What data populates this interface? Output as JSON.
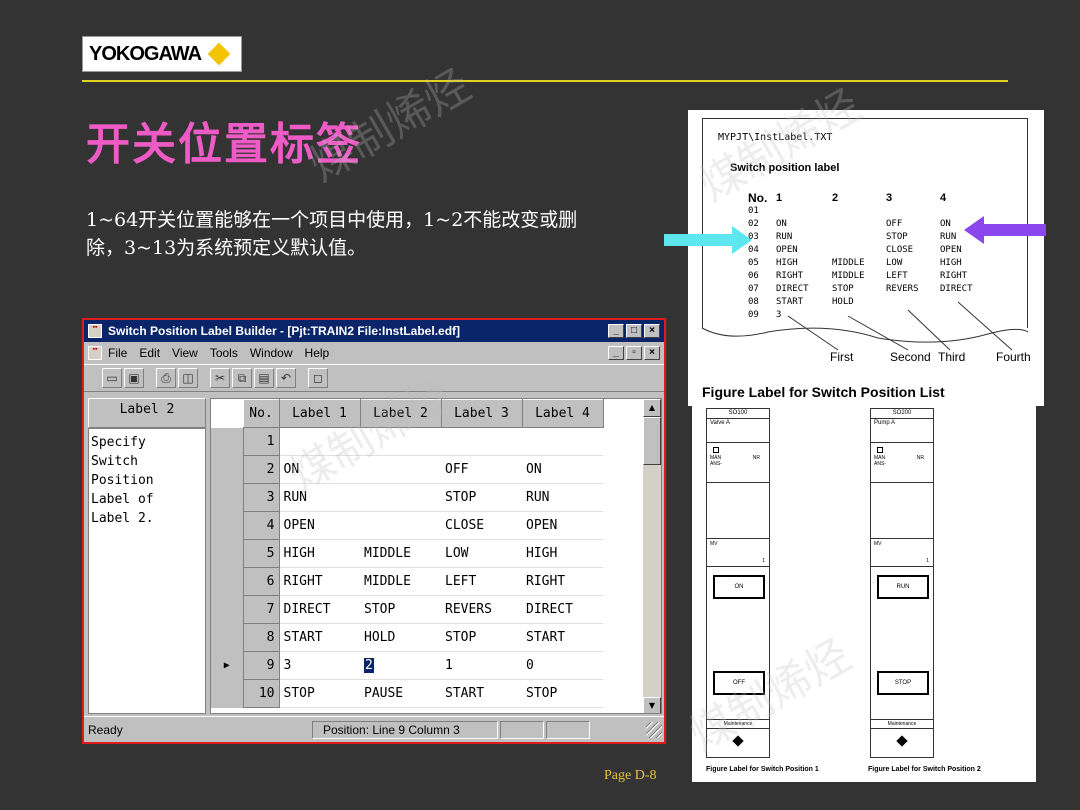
{
  "slide": {
    "logo_text": "YOKOGAWA",
    "title": "开关位置标签",
    "body_lines": [
      "1~64开关位置能够在一个项目中使用，1~2不能改变或删",
      "除，3~13为系统预定义默认值。"
    ],
    "page_num": "Page D-8",
    "watermark": "煤制烯烃"
  },
  "window": {
    "title": "Switch Position Label Builder - [Pjt:TRAIN2 File:InstLabel.edf]",
    "menu": [
      "File",
      "Edit",
      "View",
      "Tools",
      "Window",
      "Help"
    ],
    "left_panel": {
      "header": "Label 2",
      "description": "Specify\nSwitch\nPosition\nLabel of\nLabel 2."
    },
    "grid": {
      "headers": [
        "No.",
        "Label 1",
        "Label 2",
        "Label 3",
        "Label 4"
      ],
      "rows": [
        {
          "no": "1",
          "cells": [
            "",
            "",
            "",
            ""
          ]
        },
        {
          "no": "2",
          "cells": [
            "ON",
            "",
            "OFF",
            "ON"
          ]
        },
        {
          "no": "3",
          "cells": [
            "RUN",
            "",
            "STOP",
            "RUN"
          ]
        },
        {
          "no": "4",
          "cells": [
            "OPEN",
            "",
            "CLOSE",
            "OPEN"
          ]
        },
        {
          "no": "5",
          "cells": [
            "HIGH",
            "MIDDLE",
            "LOW",
            "HIGH"
          ]
        },
        {
          "no": "6",
          "cells": [
            "RIGHT",
            "MIDDLE",
            "LEFT",
            "RIGHT"
          ]
        },
        {
          "no": "7",
          "cells": [
            "DIRECT",
            "STOP",
            "REVERS",
            "DIRECT"
          ]
        },
        {
          "no": "8",
          "cells": [
            "START",
            "HOLD",
            "STOP",
            "START"
          ]
        },
        {
          "no": "9",
          "cells": [
            "3",
            "2",
            "1",
            "0"
          ],
          "current": true
        },
        {
          "no": "10",
          "cells": [
            "STOP",
            "PAUSE",
            "START",
            "STOP"
          ]
        }
      ]
    },
    "status": {
      "ready": "Ready",
      "position": "Position: Line   9 Column  3"
    }
  },
  "printout": {
    "path": "MYPJT\\InstLabel.TXT",
    "heading": "Switch position label",
    "header": [
      "No.",
      "1",
      "2",
      "3",
      "4"
    ],
    "rows": [
      [
        "01",
        "",
        "",
        "",
        ""
      ],
      [
        "02",
        "ON",
        "",
        "OFF",
        "ON"
      ],
      [
        "03",
        "RUN",
        "",
        "STOP",
        "RUN"
      ],
      [
        "04",
        "OPEN",
        "",
        "CLOSE",
        "OPEN"
      ],
      [
        "05",
        "HIGH",
        "MIDDLE",
        "LOW",
        "HIGH"
      ],
      [
        "06",
        "RIGHT",
        "MIDDLE",
        "LEFT",
        "RIGHT"
      ],
      [
        "07",
        "DIRECT",
        "STOP",
        "REVERS",
        "DIRECT"
      ],
      [
        "08",
        "START",
        "HOLD",
        "",
        ""
      ],
      [
        "09",
        "3",
        "",
        "",
        ""
      ]
    ],
    "callouts": [
      "First",
      "Second",
      "Third",
      "Fourth"
    ],
    "caption": "Figure   Label for Switch Position List"
  },
  "faceplates": [
    {
      "tag": "SO100",
      "name": "Valve A",
      "mode_left": "MAN",
      "mode_right": "NR",
      "mode_sub": "ANS-",
      "mv": "MV",
      "mv_value": "1",
      "btn_top": "ON",
      "btn_bottom": "OFF",
      "maint": "Maintenance",
      "caption": "Figure   Label for Switch Position 1"
    },
    {
      "tag": "SO200",
      "name": "Pump A",
      "mode_left": "MAN",
      "mode_right": "NR",
      "mode_sub": "ANS-",
      "mv": "MV",
      "mv_value": "1",
      "btn_top": "RUN",
      "btn_bottom": "STOP",
      "maint": "Maintenance",
      "caption": "Figure   Label for Switch Position 2"
    }
  ],
  "colors": {
    "title": "#ee5bc6",
    "rule": "#e2d21d",
    "cyan_arrow": "#5ee7f0",
    "purple_arrow": "#8b46ee",
    "window_border": "#e11a1a",
    "titlebar": "#0a246a"
  }
}
